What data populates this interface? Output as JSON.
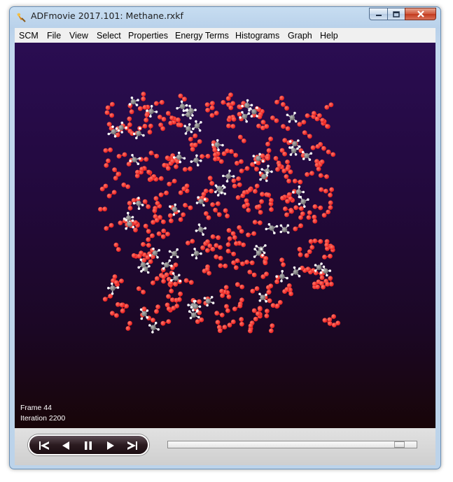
{
  "window": {
    "title": "ADFmovie 2017.101: Methane.rxkf"
  },
  "menu": {
    "items": [
      "SCM",
      "File",
      "View",
      "Select",
      "Properties",
      "Energy Terms",
      "Histograms",
      "Graph",
      "Help"
    ]
  },
  "viewer": {
    "frame_label": "Frame 44",
    "iteration_label": "Iteration 2200",
    "atom_colors": {
      "oxygen": "#e81e1e",
      "carbon": "#6e6e6e",
      "hydrogen": "#f2f2f2"
    },
    "background_top": "#2a0d52",
    "background_bottom": "#180508"
  },
  "transport": {
    "buttons": [
      "skip-to-start-icon",
      "step-back-icon",
      "pause-icon",
      "step-forward-icon",
      "skip-to-end-icon"
    ]
  },
  "timeline": {
    "position_fraction": 0.95
  }
}
